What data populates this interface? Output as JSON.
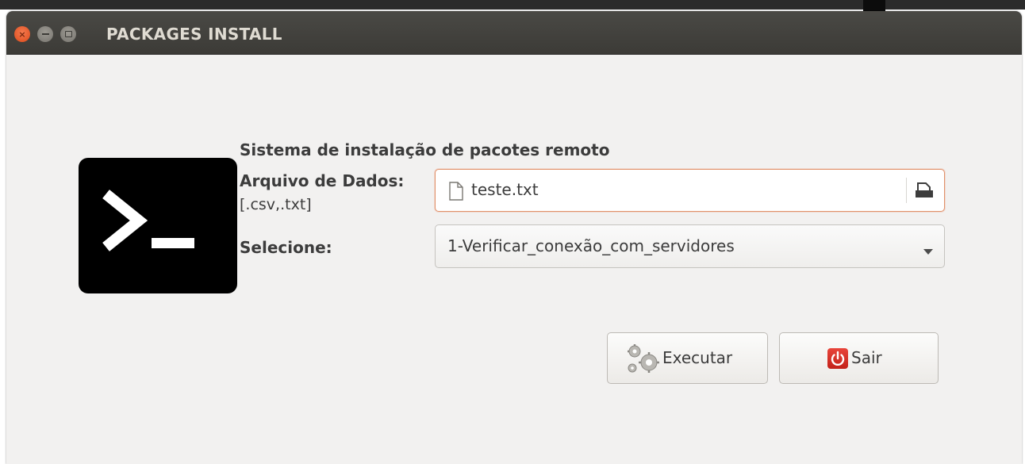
{
  "window": {
    "title": "PACKAGES INSTALL",
    "close_glyph": "×"
  },
  "colors": {
    "titlebar": "#3c3b37",
    "window_bg": "#f2f1f0",
    "focus_accent": "#e0916a",
    "close_button": "#dd4b1b",
    "power_red": "#c3221a"
  },
  "icons": {
    "logo": "terminal-prompt-icon",
    "file": "file-icon",
    "open": "folder-open-icon",
    "dropdown": "chevron-down-icon",
    "executar": "gears-icon",
    "sair": "power-icon"
  },
  "form": {
    "heading": "Sistema de instalação de pacotes remoto",
    "file_label": "Arquivo de Dados:",
    "file_ext_hint": "[.csv,.txt]",
    "file_value": "teste.txt",
    "select_label": "Selecione:",
    "select_value": "1-Verificar_conexão_com_servidores"
  },
  "buttons": {
    "executar": "Executar",
    "sair": "Sair"
  }
}
